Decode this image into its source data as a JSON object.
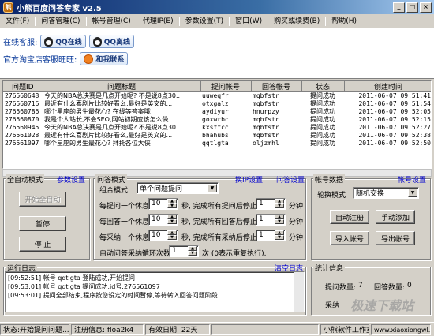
{
  "window": {
    "title": "小熊百度问答专家 v2.5",
    "minimize": "_",
    "maximize": "□",
    "close": "×"
  },
  "menu": [
    "文件(F)",
    "问答管理(C)",
    "帐号管理(C)",
    "代理IP(E)",
    "参数设置(T)",
    "窗口(W)",
    "购买或续费(B)",
    "帮助(H)"
  ],
  "service": {
    "online_label": "在线客服:",
    "qq_online": "QQ在线",
    "qq_offline": "QQ离线",
    "taobao_label": "官方淘宝店客服旺旺:",
    "contact": "和我联系"
  },
  "grid": {
    "headers": [
      "问题ID",
      "问题标题",
      "提问帐号",
      "回答帐号",
      "状态",
      "创建时间"
    ],
    "rows": [
      [
        "276560648",
        "今天的NBA总决赛是几点开始呢? 不是说8点30...",
        "uuweqfr",
        "mqbfstr",
        "提问成功",
        "2011-06-07  09:51:41"
      ],
      [
        "276560716",
        "最近有什么喜剧片比较好看么,最好是英文的...",
        "otxgalz",
        "mqbfstr",
        "提问成功",
        "2011-06-07  09:51:54"
      ],
      [
        "276560786",
        "哪个星座的男生最花心? 在线等答案哦",
        "aydiyur",
        "hnurpzy",
        "提问成功",
        "2011-06-07  09:52:05"
      ],
      [
        "276560870",
        "我是个人站长,不会SEO,网站初期应该怎么做...",
        "goxwrbc",
        "mqbfstr",
        "提问成功",
        "2011-06-07  09:52:15"
      ],
      [
        "276560945",
        "今天的NBA总决赛是几点开始呢? 不是说8点30...",
        "kxsffcc",
        "mqbfstr",
        "提问成功",
        "2011-06-07  09:52:27"
      ],
      [
        "276561028",
        "最近有什么喜剧片比较好看么,最好是英文的...",
        "bhahubs",
        "mqbfstr",
        "提问成功",
        "2011-06-07  09:52:38"
      ],
      [
        "276561097",
        "哪个星座的男生最花心? 拜托各位大侠",
        "qqtlgta",
        "oljzmhl",
        "提问成功",
        "2011-06-07  09:52:50"
      ]
    ]
  },
  "auto": {
    "title": "全自动模式",
    "settings_link": "参数设置",
    "start": "开始全自动",
    "pause": "暂停",
    "stop": "停 止"
  },
  "qa": {
    "title": "问答模式",
    "ip_link": "换IP设置",
    "qa_link": "问答设置",
    "combo_label": "组合模式",
    "combo_value": "单个问题提问",
    "rows": [
      {
        "label": "每提问一个休息",
        "value": "10",
        "suffix": "秒, 完成所有提问后停止",
        "value2": "1",
        "unit": "分钟"
      },
      {
        "label": "每回答一个休息",
        "value": "10",
        "suffix": "秒, 完成所有回答后停止",
        "value2": "1",
        "unit": "分钟"
      },
      {
        "label": "每采纳一个休息",
        "value": "10",
        "suffix": "秒, 完成所有采纳后停止",
        "value2": "1",
        "unit": "分钟"
      }
    ],
    "loop_label": "自动问答采纳循环次数",
    "loop_value": "1",
    "loop_suffix": "次 (0表示重复执行)."
  },
  "account": {
    "title": "帐号数据",
    "link": "帐号设置",
    "rotate_label": "轮换模式",
    "rotate_value": "随机交换",
    "auto_register": "自动注册",
    "manual_add": "手动添加",
    "import": "导入帐号",
    "export": "导出帐号"
  },
  "log": {
    "title": "运行日志",
    "clear": "清空日志",
    "lines": [
      "[09:52:51] 帐号 qqtlgta 登陆成功,开始提问",
      "[09:53:01] 帐号 qqtlgta 提问成功,id号:276561097",
      "[09:53:01] 提问全部结束,程序按您设定的时间暂停,等待转入回答问题阶段"
    ]
  },
  "stats": {
    "title": "统计信息",
    "ask_label": "提问数量:",
    "ask_value": "7",
    "answer_label": "回答数量:",
    "answer_value": "0",
    "accept_label": "采纳"
  },
  "status": {
    "state": "状态:开始提问问题...",
    "reg_label": "注册信息:",
    "reg_value": "floa2k4",
    "expiry_label": "有效日期:",
    "expiry_value": "22天",
    "studio": "小熊软件工作室",
    "site": "www.xiaoxiongwl.com"
  },
  "watermark": "极速下载站"
}
